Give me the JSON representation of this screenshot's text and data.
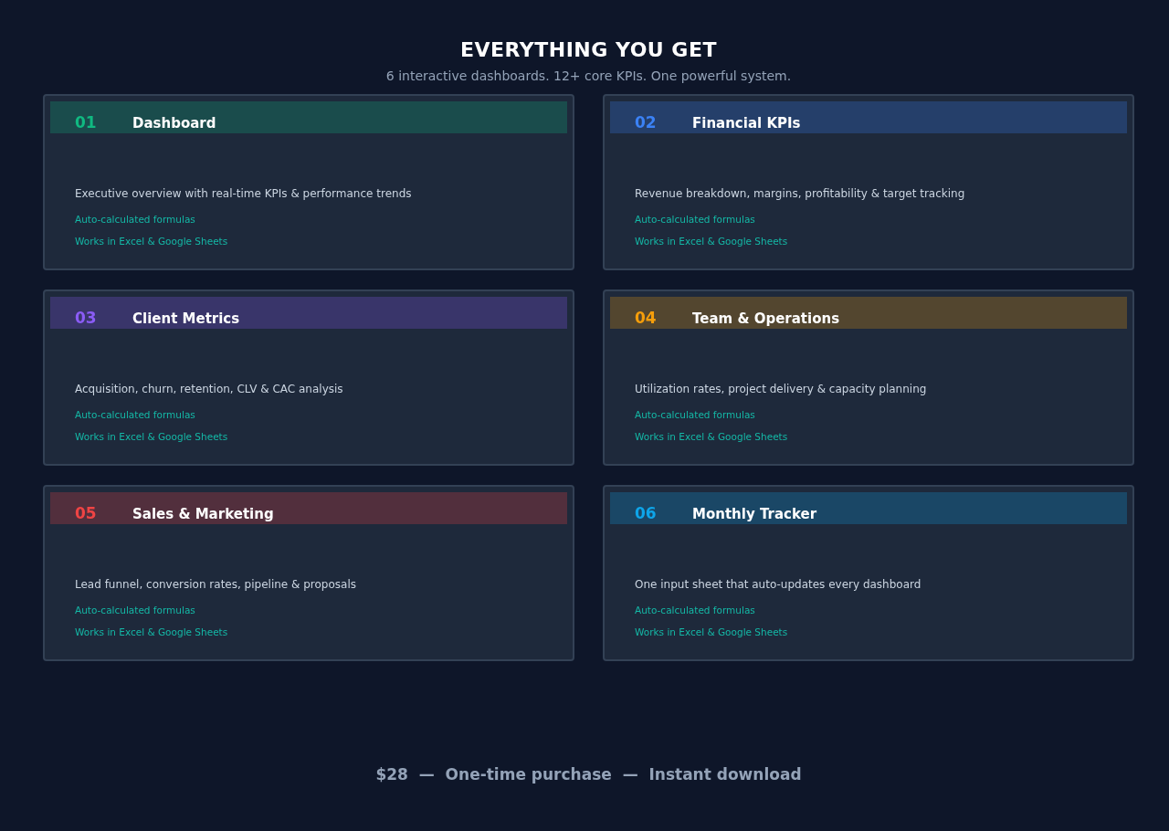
{
  "title": "EVERYTHING YOU GET",
  "subtitle": "6 interactive dashboards. 12+ core KPIs. One powerful system.",
  "cards": [
    {
      "number": "01",
      "title": "Dashboard",
      "color": "#10b981",
      "description": "Executive overview with real-time KPIs & performance trends",
      "features": [
        "Auto-calculated formulas",
        "Works in Excel & Google Sheets"
      ]
    },
    {
      "number": "02",
      "title": "Financial KPIs",
      "color": "#3b82f6",
      "description": "Revenue breakdown, margins, profitability & target tracking",
      "features": [
        "Auto-calculated formulas",
        "Works in Excel & Google Sheets"
      ]
    },
    {
      "number": "03",
      "title": "Client Metrics",
      "color": "#8b5cf6",
      "description": "Acquisition, churn, retention, CLV & CAC analysis",
      "features": [
        "Auto-calculated formulas",
        "Works in Excel & Google Sheets"
      ]
    },
    {
      "number": "04",
      "title": "Team & Operations",
      "color": "#f59e0b",
      "description": "Utilization rates, project delivery & capacity planning",
      "features": [
        "Auto-calculated formulas",
        "Works in Excel & Google Sheets"
      ]
    },
    {
      "number": "05",
      "title": "Sales & Marketing",
      "color": "#ef4444",
      "description": "Lead funnel, conversion rates, pipeline & proposals",
      "features": [
        "Auto-calculated formulas",
        "Works in Excel & Google Sheets"
      ]
    },
    {
      "number": "06",
      "title": "Monthly Tracker",
      "color": "#0ea5e9",
      "description": "One input sheet that auto-updates every dashboard",
      "features": [
        "Auto-calculated formulas",
        "Works in Excel & Google Sheets"
      ]
    }
  ],
  "footer": "$28  —  One-time purchase  —  Instant download"
}
